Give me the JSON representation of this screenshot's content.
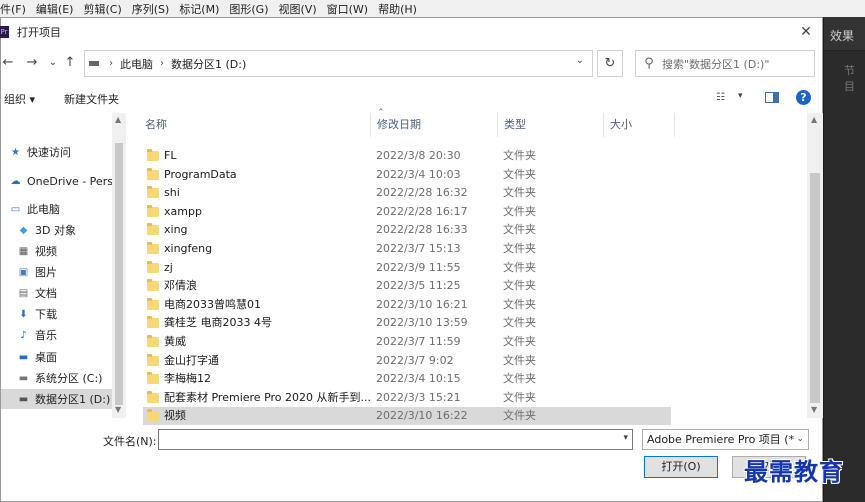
{
  "menubar": [
    "件(F)",
    "编辑(E)",
    "剪辑(C)",
    "序列(S)",
    "标记(M)",
    "图形(G)",
    "视图(V)",
    "窗口(W)",
    "帮助(H)"
  ],
  "right_panel": {
    "tab": "效果",
    "subtab": "节目"
  },
  "dialog": {
    "title": "打开项目",
    "title_icon": "Pr",
    "close": "✕",
    "nav": {
      "back": "←",
      "forward": "→",
      "recent": "⌄",
      "up": "↑"
    },
    "breadcrumb": [
      "此电脑",
      "数据分区1 (D:)"
    ],
    "search_placeholder": "搜索\"数据分区1 (D:)\"",
    "toolbar": {
      "organize": "组织 ▾",
      "new_folder": "新建文件夹"
    }
  },
  "nav_pane": [
    {
      "label": "快速访问",
      "icon": "quick-access-star-icon",
      "glyph": "★",
      "color": "#2b78d4"
    },
    {
      "label": "OneDrive - Perso",
      "icon": "cloud-icon",
      "glyph": "☁",
      "color": "#1f6fd1"
    },
    {
      "label": "此电脑",
      "icon": "computer-icon",
      "glyph": "▭",
      "color": "#2b78d4"
    },
    {
      "label": "3D 对象",
      "icon": "cube-icon",
      "glyph": "◆",
      "color": "#3ba0e0"
    },
    {
      "label": "视频",
      "icon": "video-icon",
      "glyph": "▦",
      "color": "#555"
    },
    {
      "label": "图片",
      "icon": "picture-icon",
      "glyph": "▣",
      "color": "#4a7bb5"
    },
    {
      "label": "文档",
      "icon": "document-icon",
      "glyph": "▤",
      "color": "#666"
    },
    {
      "label": "下载",
      "icon": "download-icon",
      "glyph": "⬇",
      "color": "#1f6fd1"
    },
    {
      "label": "音乐",
      "icon": "music-icon",
      "glyph": "♪",
      "color": "#1f6fd1"
    },
    {
      "label": "桌面",
      "icon": "desktop-icon",
      "glyph": "▬",
      "color": "#1f6fd1"
    },
    {
      "label": "系统分区 (C:)",
      "icon": "drive-c-icon",
      "glyph": "▬",
      "color": "#777"
    },
    {
      "label": "数据分区1 (D:)",
      "icon": "drive-d-icon",
      "glyph": "▬",
      "color": "#555",
      "selected": true
    },
    {
      "label": "网络",
      "icon": "network-icon",
      "glyph": "⊞",
      "color": "#2b78d4"
    }
  ],
  "columns": {
    "name": "名称",
    "date": "修改日期",
    "type": "类型",
    "size": "大小"
  },
  "files": [
    {
      "name": "FL",
      "date": "2022/3/8 20:30",
      "type": "文件夹"
    },
    {
      "name": "ProgramData",
      "date": "2022/3/4 10:03",
      "type": "文件夹"
    },
    {
      "name": "shi",
      "date": "2022/2/28 16:32",
      "type": "文件夹"
    },
    {
      "name": "xampp",
      "date": "2022/2/28 16:17",
      "type": "文件夹"
    },
    {
      "name": "xing",
      "date": "2022/2/28 16:33",
      "type": "文件夹"
    },
    {
      "name": "xingfeng",
      "date": "2022/3/7 15:13",
      "type": "文件夹"
    },
    {
      "name": "zj",
      "date": "2022/3/9 11:55",
      "type": "文件夹"
    },
    {
      "name": "邓倩浪",
      "date": "2022/3/5 11:25",
      "type": "文件夹"
    },
    {
      "name": "电商2033曾鸣慧01",
      "date": "2022/3/10 16:21",
      "type": "文件夹"
    },
    {
      "name": "龚桂芝 电商2033 4号",
      "date": "2022/3/10 13:59",
      "type": "文件夹"
    },
    {
      "name": "黄威",
      "date": "2022/3/7 11:59",
      "type": "文件夹"
    },
    {
      "name": "金山打字通",
      "date": "2022/3/7 9:02",
      "type": "文件夹"
    },
    {
      "name": "李梅梅12",
      "date": "2022/3/4 10:15",
      "type": "文件夹"
    },
    {
      "name": "配套素材 Premiere Pro 2020 从新手到...",
      "date": "2022/3/3 15:21",
      "type": "文件夹"
    },
    {
      "name": "视频",
      "date": "2022/3/10 16:22",
      "type": "文件夹",
      "selected": true
    }
  ],
  "bottom": {
    "filename_label": "文件名(N):",
    "filename_value": "",
    "filetype": "Adobe Premiere Pro 项目 (*.",
    "open": "打开(O)",
    "cancel": "取消"
  },
  "watermark": "最需教育"
}
